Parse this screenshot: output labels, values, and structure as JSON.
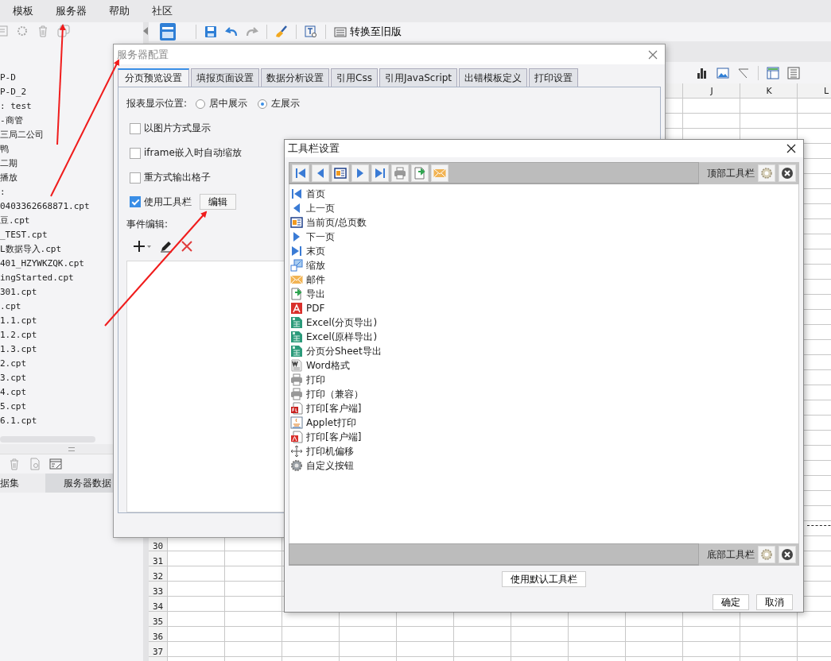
{
  "menu_bar": {
    "items": [
      "模板",
      "服务器",
      "帮助",
      "社区"
    ]
  },
  "file_tree": {
    "items": [
      "P-D",
      "P-D_2",
      ": test",
      "-商管",
      "三局二公司",
      "鸭",
      "二期",
      "播放",
      ":",
      "0403362668871.cpt",
      "豆.cpt",
      "_TEST.cpt",
      "L数据导入.cpt",
      "401_HZYWKZQK.cpt",
      "ingStarted.cpt",
      "301.cpt",
      ".cpt",
      "1.1.cpt",
      "1.2.cpt",
      "1.3.cpt",
      "2.cpt",
      "3.cpt",
      "4.cpt",
      "5.cpt",
      "6.1.cpt"
    ]
  },
  "dataset_tabs": [
    {
      "label": "据集",
      "selected": true
    },
    {
      "label": "服务器数据",
      "selected": false
    }
  ],
  "main_toolbar": {
    "convert_button": "转换至旧版"
  },
  "grid": {
    "column_headers": [
      "J",
      "K",
      "L"
    ],
    "row_numbers": [
      "30",
      "31",
      "32",
      "33",
      "34",
      "35",
      "36",
      "37"
    ]
  },
  "server_config_dialog": {
    "title": "服务器配置",
    "tabs": [
      {
        "label": "分页预览设置",
        "selected": true
      },
      {
        "label": "填报页面设置",
        "selected": false
      },
      {
        "label": "数据分析设置",
        "selected": false
      },
      {
        "label": "引用Css",
        "selected": false
      },
      {
        "label": "引用JavaScript",
        "selected": false
      },
      {
        "label": "出错模板定义",
        "selected": false
      },
      {
        "label": "打印设置",
        "selected": false
      }
    ],
    "display_position": {
      "label": "报表显示位置:",
      "options": [
        {
          "label": "居中展示",
          "selected": false
        },
        {
          "label": "左展示",
          "selected": true
        }
      ]
    },
    "options": [
      {
        "label": "以图片方式显示",
        "checked": false
      },
      {
        "label": "iframe嵌入时自动缩放",
        "checked": false
      },
      {
        "label": "重方式输出格子",
        "checked": false
      },
      {
        "label": "使用工具栏",
        "checked": true,
        "button": "编辑"
      }
    ],
    "event_editor": {
      "label": "事件编辑:"
    }
  },
  "toolbar_dialog": {
    "title": "工具栏设置",
    "top_toolbar": {
      "label": "顶部工具栏",
      "buttons": [
        {
          "kind": "first"
        },
        {
          "kind": "prev"
        },
        {
          "kind": "page"
        },
        {
          "kind": "next"
        },
        {
          "kind": "last"
        },
        {
          "kind": "print"
        },
        {
          "kind": "export"
        },
        {
          "kind": "mail"
        }
      ]
    },
    "items": [
      {
        "label": "首页",
        "kind": "first"
      },
      {
        "label": "上一页",
        "kind": "prev"
      },
      {
        "label": "当前页/总页数",
        "kind": "page"
      },
      {
        "label": "下一页",
        "kind": "next"
      },
      {
        "label": "末页",
        "kind": "last"
      },
      {
        "label": "缩放",
        "kind": "zoom"
      },
      {
        "label": "邮件",
        "kind": "mail"
      },
      {
        "label": "导出",
        "kind": "export"
      },
      {
        "label": "PDF",
        "kind": "pdf"
      },
      {
        "label": "Excel(分页导出)",
        "kind": "excel"
      },
      {
        "label": "Excel(原样导出)",
        "kind": "excel"
      },
      {
        "label": "分页分Sheet导出",
        "kind": "excel"
      },
      {
        "label": "Word格式",
        "kind": "word"
      },
      {
        "label": "打印",
        "kind": "print"
      },
      {
        "label": "打印（兼容）",
        "kind": "print"
      },
      {
        "label": "打印[客户端]",
        "kind": "flashprint"
      },
      {
        "label": "Applet打印",
        "kind": "applet"
      },
      {
        "label": "打印[客户端]",
        "kind": "pdfprint"
      },
      {
        "label": "打印机偏移",
        "kind": "move"
      },
      {
        "label": "自定义按钮",
        "kind": "gear"
      }
    ],
    "bottom_toolbar": {
      "label": "底部工具栏"
    },
    "default_button": "使用默认工具栏",
    "ok_button": "确定",
    "cancel_button": "取消"
  }
}
